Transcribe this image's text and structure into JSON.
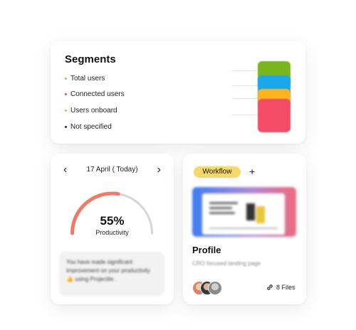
{
  "segments": {
    "title": "Segments",
    "legend": [
      {
        "label": "Total users",
        "color": "#a5c93b"
      },
      {
        "label": "Connected users",
        "color": "#f04e5e"
      },
      {
        "label": "Users onboard",
        "color": "#f5b12a"
      },
      {
        "label": "Not specified",
        "color": "#1f2a44"
      }
    ],
    "stack_colors": [
      "#79b51c",
      "#1aa7ec",
      "#fcb51e",
      "#f44c67"
    ]
  },
  "productivity": {
    "date": "17 April ( Today)",
    "prev_icon": "chevron-left-icon",
    "next_icon": "chevron-right-icon",
    "percent_label": "55%",
    "percent_value": 0.55,
    "label": "Productivity",
    "message": "You have made significant improvement on your productivity 👍 using Projectile .",
    "gauge_color": "#f07a6a",
    "gauge_track_color": "#d6d6d6"
  },
  "profile": {
    "tag": "Workflow",
    "add_icon": "plus-icon",
    "title": "Profile",
    "subtitle": "CRO focused landing page",
    "files": "8 Files",
    "files_icon": "link-icon",
    "tag_color": "#f7d86b"
  }
}
